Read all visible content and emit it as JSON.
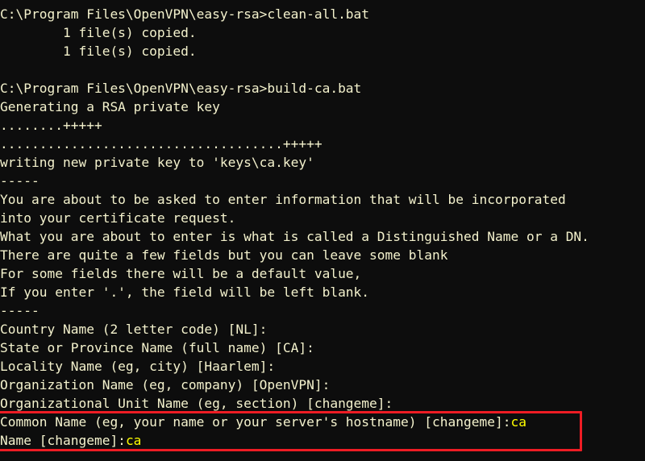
{
  "terminal": {
    "background_color": "#0d0d0d",
    "text_color": "#f4f2cd",
    "input_color": "#ffff00",
    "highlight_color": "#ee1c24",
    "lines": [
      {
        "id": "cmd-clean-all",
        "text": "C:\\Program Files\\OpenVPN\\easy-rsa>clean-all.bat"
      },
      {
        "id": "copied-1",
        "text": "        1 file(s) copied."
      },
      {
        "id": "copied-2",
        "text": "        1 file(s) copied."
      },
      {
        "id": "blank-1",
        "text": ""
      },
      {
        "id": "cmd-build-ca",
        "text": "C:\\Program Files\\OpenVPN\\easy-rsa>build-ca.bat"
      },
      {
        "id": "generating-rsa-key",
        "text": "Generating a RSA private key"
      },
      {
        "id": "progress-dots-1",
        "text": "........+++++"
      },
      {
        "id": "progress-dots-2",
        "text": "....................................+++++"
      },
      {
        "id": "writing-key",
        "text": "writing new private key to 'keys\\ca.key'"
      },
      {
        "id": "separator-1",
        "text": "-----"
      },
      {
        "id": "info-1",
        "text": "You are about to be asked to enter information that will be incorporated"
      },
      {
        "id": "info-2",
        "text": "into your certificate request."
      },
      {
        "id": "info-3",
        "text": "What you are about to enter is what is called a Distinguished Name or a DN."
      },
      {
        "id": "info-4",
        "text": "There are quite a few fields but you can leave some blank"
      },
      {
        "id": "info-5",
        "text": "For some fields there will be a default value,"
      },
      {
        "id": "info-6",
        "text": "If you enter '.', the field will be left blank."
      },
      {
        "id": "separator-2",
        "text": "-----"
      },
      {
        "id": "prompt-country",
        "text": "Country Name (2 letter code) [NL]:"
      },
      {
        "id": "prompt-state",
        "text": "State or Province Name (full name) [CA]:"
      },
      {
        "id": "prompt-locality",
        "text": "Locality Name (eg, city) [Haarlem]:"
      },
      {
        "id": "prompt-organization",
        "text": "Organization Name (eg, company) [OpenVPN]:"
      },
      {
        "id": "prompt-org-unit",
        "text": "Organizational Unit Name (eg, section) [changeme]:"
      },
      {
        "id": "prompt-common-name",
        "text": "Common Name (eg, your name or your server's hostname) [changeme]:",
        "input": "ca"
      },
      {
        "id": "prompt-name",
        "text": "Name [changeme]:",
        "input": "ca"
      }
    ]
  },
  "annotation": {
    "highlight_label": "red-rectangle-highlight"
  }
}
